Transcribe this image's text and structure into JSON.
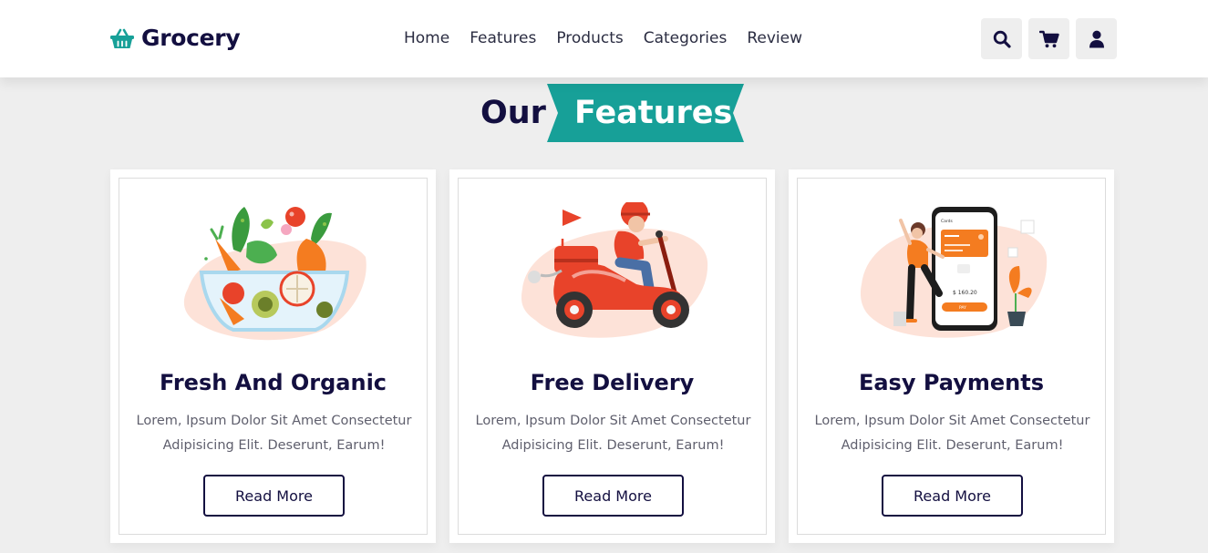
{
  "brand": {
    "name": "Grocery",
    "icon": "basket-icon",
    "color": "#17a098"
  },
  "nav": [
    "Home",
    "Features",
    "Products",
    "Categories",
    "Review"
  ],
  "header_icons": [
    "search-icon",
    "cart-icon",
    "user-icon"
  ],
  "section": {
    "title_plain": "Our",
    "title_highlight": "Features",
    "accent": "#17a098"
  },
  "cards": [
    {
      "title": "Fresh And Organic",
      "text": "Lorem, Ipsum Dolor Sit Amet Consectetur Adipisicing Elit. Deserunt, Earum!",
      "button": "Read More",
      "illustration": "vegetable-bowl-illustration"
    },
    {
      "title": "Free Delivery",
      "text": "Lorem, Ipsum Dolor Sit Amet Consectetur Adipisicing Elit. Deserunt, Earum!",
      "button": "Read More",
      "illustration": "delivery-scooter-illustration"
    },
    {
      "title": "Easy Payments",
      "text": "Lorem, Ipsum Dolor Sit Amet Consectetur Adipisicing Elit. Deserunt, Earum!",
      "button": "Read More",
      "illustration": "mobile-payment-illustration"
    }
  ],
  "phone_screen": {
    "label": "Cards",
    "amount": "$ 160.20",
    "pay": "PAY"
  }
}
